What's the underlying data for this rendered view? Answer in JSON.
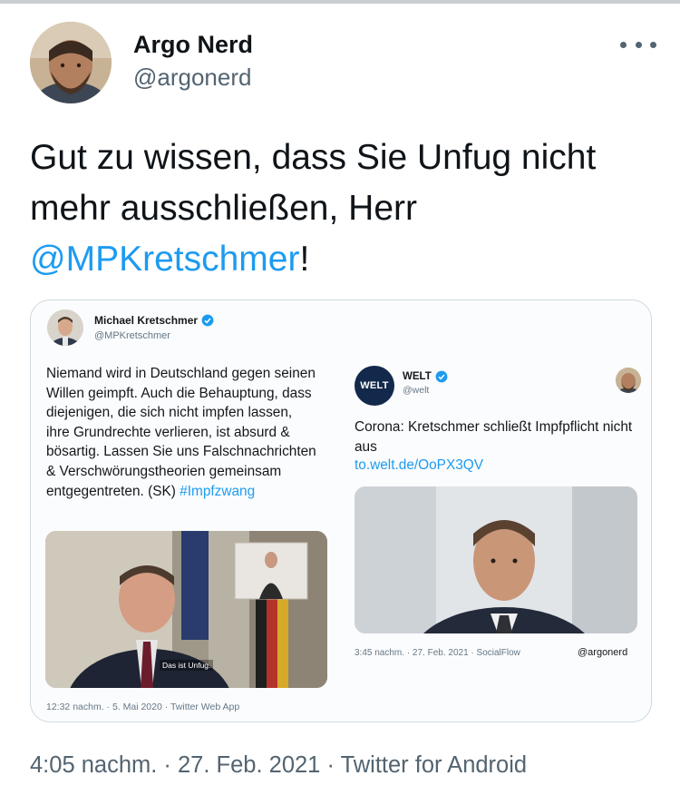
{
  "tweet": {
    "display_name": "Argo Nerd",
    "handle": "@argonerd",
    "text_before": "Gut zu wissen, dass Sie Unfug nicht mehr ausschließen, Herr ",
    "mention": "@MPKretschmer",
    "text_after": "!",
    "meta": "4:05 nachm. · 27. Feb. 2021 · Twitter for Android",
    "avatar_icon": "bearded-man-avatar",
    "more_icon": "more-options-icon"
  },
  "embedded_left": {
    "name": "Michael Kretschmer",
    "handle": "@MPKretschmer",
    "text": "Niemand wird in Deutschland gegen seinen Willen geimpft. Auch die Behauptung, dass diejenigen, die sich nicht impfen lassen, ihre Grundrechte verlieren, ist absurd & bösartig. Lassen Sie uns Falschnachrichten & Verschwörungstheorien  gemeinsam entgegentreten. (SK) ",
    "hashtag": "#Impfzwang",
    "video_caption": "Das ist Unfug.",
    "footer": "12:32 nachm. · 5. Mai 2020 · Twitter Web App"
  },
  "embedded_right": {
    "logo_text": "WELT",
    "name": "WELT",
    "handle": "@welt",
    "text": "Corona: Kretschmer schließt Impfpflicht nicht aus",
    "link": "to.welt.de/OoPX3QV",
    "footer": "3:45 nachm. · 27. Feb. 2021 · SocialFlow",
    "credit": "@argonerd"
  },
  "colors": {
    "accent": "#1d9bf0",
    "text": "#0f1419",
    "secondary": "#536471",
    "welt_navy": "#13294b"
  }
}
